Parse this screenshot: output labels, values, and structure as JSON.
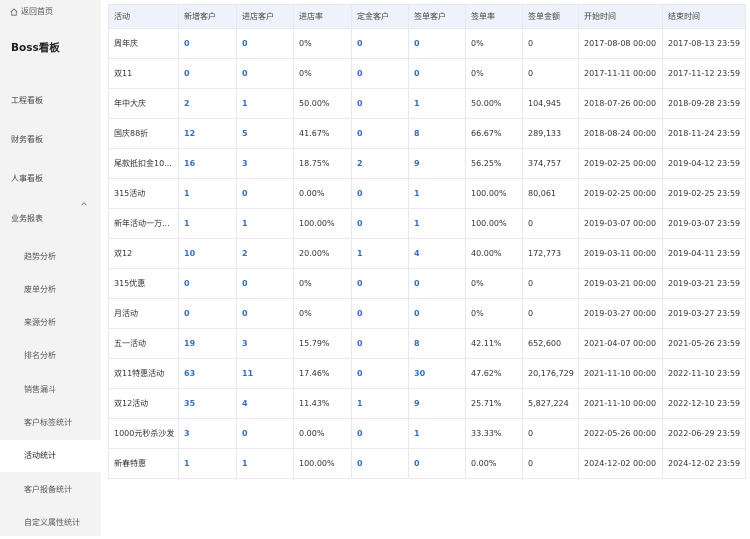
{
  "sidebar": {
    "back_label": "返回首页",
    "brand": "Boss看板",
    "nav": [
      {
        "label": "工程看板"
      },
      {
        "label": "财务看板"
      },
      {
        "label": "人事看板"
      },
      {
        "label": "业务报表"
      }
    ],
    "sub_items": [
      {
        "label": "趋势分析"
      },
      {
        "label": "废单分析"
      },
      {
        "label": "来源分析"
      },
      {
        "label": "排名分析"
      },
      {
        "label": "销售漏斗"
      },
      {
        "label": "客户标签统计"
      },
      {
        "label": "活动统计",
        "active": true
      },
      {
        "label": "客户报备统计"
      },
      {
        "label": "自定义属性统计"
      }
    ]
  },
  "table": {
    "headers": [
      "活动",
      "新增客户",
      "进店客户",
      "进店率",
      "定金客户",
      "签单客户",
      "签单率",
      "签单金额",
      "开始时间",
      "结束时间"
    ],
    "rows": [
      [
        "周年庆",
        "0",
        "0",
        "0%",
        "0",
        "0",
        "0%",
        "0",
        "2017-08-08 00:00",
        "2017-08-13 23:59"
      ],
      [
        "双11",
        "0",
        "0",
        "0%",
        "0",
        "0",
        "0%",
        "0",
        "2017-11-11 00:00",
        "2017-11-12 23:59"
      ],
      [
        "年中大庆",
        "2",
        "1",
        "50.00%",
        "0",
        "1",
        "50.00%",
        "104,945",
        "2018-07-26 00:00",
        "2018-09-28 23:59"
      ],
      [
        "国庆88折",
        "12",
        "5",
        "41.67%",
        "0",
        "8",
        "66.67%",
        "289,133",
        "2018-08-24 00:00",
        "2018-11-24 23:59"
      ],
      [
        "尾款抵扣金10...",
        "16",
        "3",
        "18.75%",
        "2",
        "9",
        "56.25%",
        "374,757",
        "2019-02-25 00:00",
        "2019-04-12 23:59"
      ],
      [
        "315活动",
        "1",
        "0",
        "0.00%",
        "0",
        "1",
        "100.00%",
        "80,061",
        "2019-02-25 00:00",
        "2019-02-25 23:59"
      ],
      [
        "新年活动一万...",
        "1",
        "1",
        "100.00%",
        "0",
        "1",
        "100.00%",
        "0",
        "2019-03-07 00:00",
        "2019-03-07 23:59"
      ],
      [
        "双12",
        "10",
        "2",
        "20.00%",
        "1",
        "4",
        "40.00%",
        "172,773",
        "2019-03-11 00:00",
        "2019-04-11 23:59"
      ],
      [
        "315优惠",
        "0",
        "0",
        "0%",
        "0",
        "0",
        "0%",
        "0",
        "2019-03-21 00:00",
        "2019-03-21 23:59"
      ],
      [
        "月活动",
        "0",
        "0",
        "0%",
        "0",
        "0",
        "0%",
        "0",
        "2019-03-27 00:00",
        "2019-03-27 23:59"
      ],
      [
        "五一活动",
        "19",
        "3",
        "15.79%",
        "0",
        "8",
        "42.11%",
        "652,600",
        "2021-04-07 00:00",
        "2021-05-26 23:59"
      ],
      [
        "双11特惠活动",
        "63",
        "11",
        "17.46%",
        "0",
        "30",
        "47.62%",
        "20,176,729",
        "2021-11-10 00:00",
        "2022-11-10 23:59"
      ],
      [
        "双12活动",
        "35",
        "4",
        "11.43%",
        "1",
        "9",
        "25.71%",
        "5,827,224",
        "2021-11-10 00:00",
        "2022-12-10 23:59"
      ],
      [
        "1000元秒杀沙发",
        "3",
        "0",
        "0.00%",
        "0",
        "1",
        "33.33%",
        "0",
        "2022-05-26 00:00",
        "2022-06-29 23:59"
      ],
      [
        "新春特惠",
        "1",
        "1",
        "100.00%",
        "0",
        "0",
        "0.00%",
        "0",
        "2024-12-02 00:00",
        "2024-12-02 23:59"
      ]
    ]
  }
}
